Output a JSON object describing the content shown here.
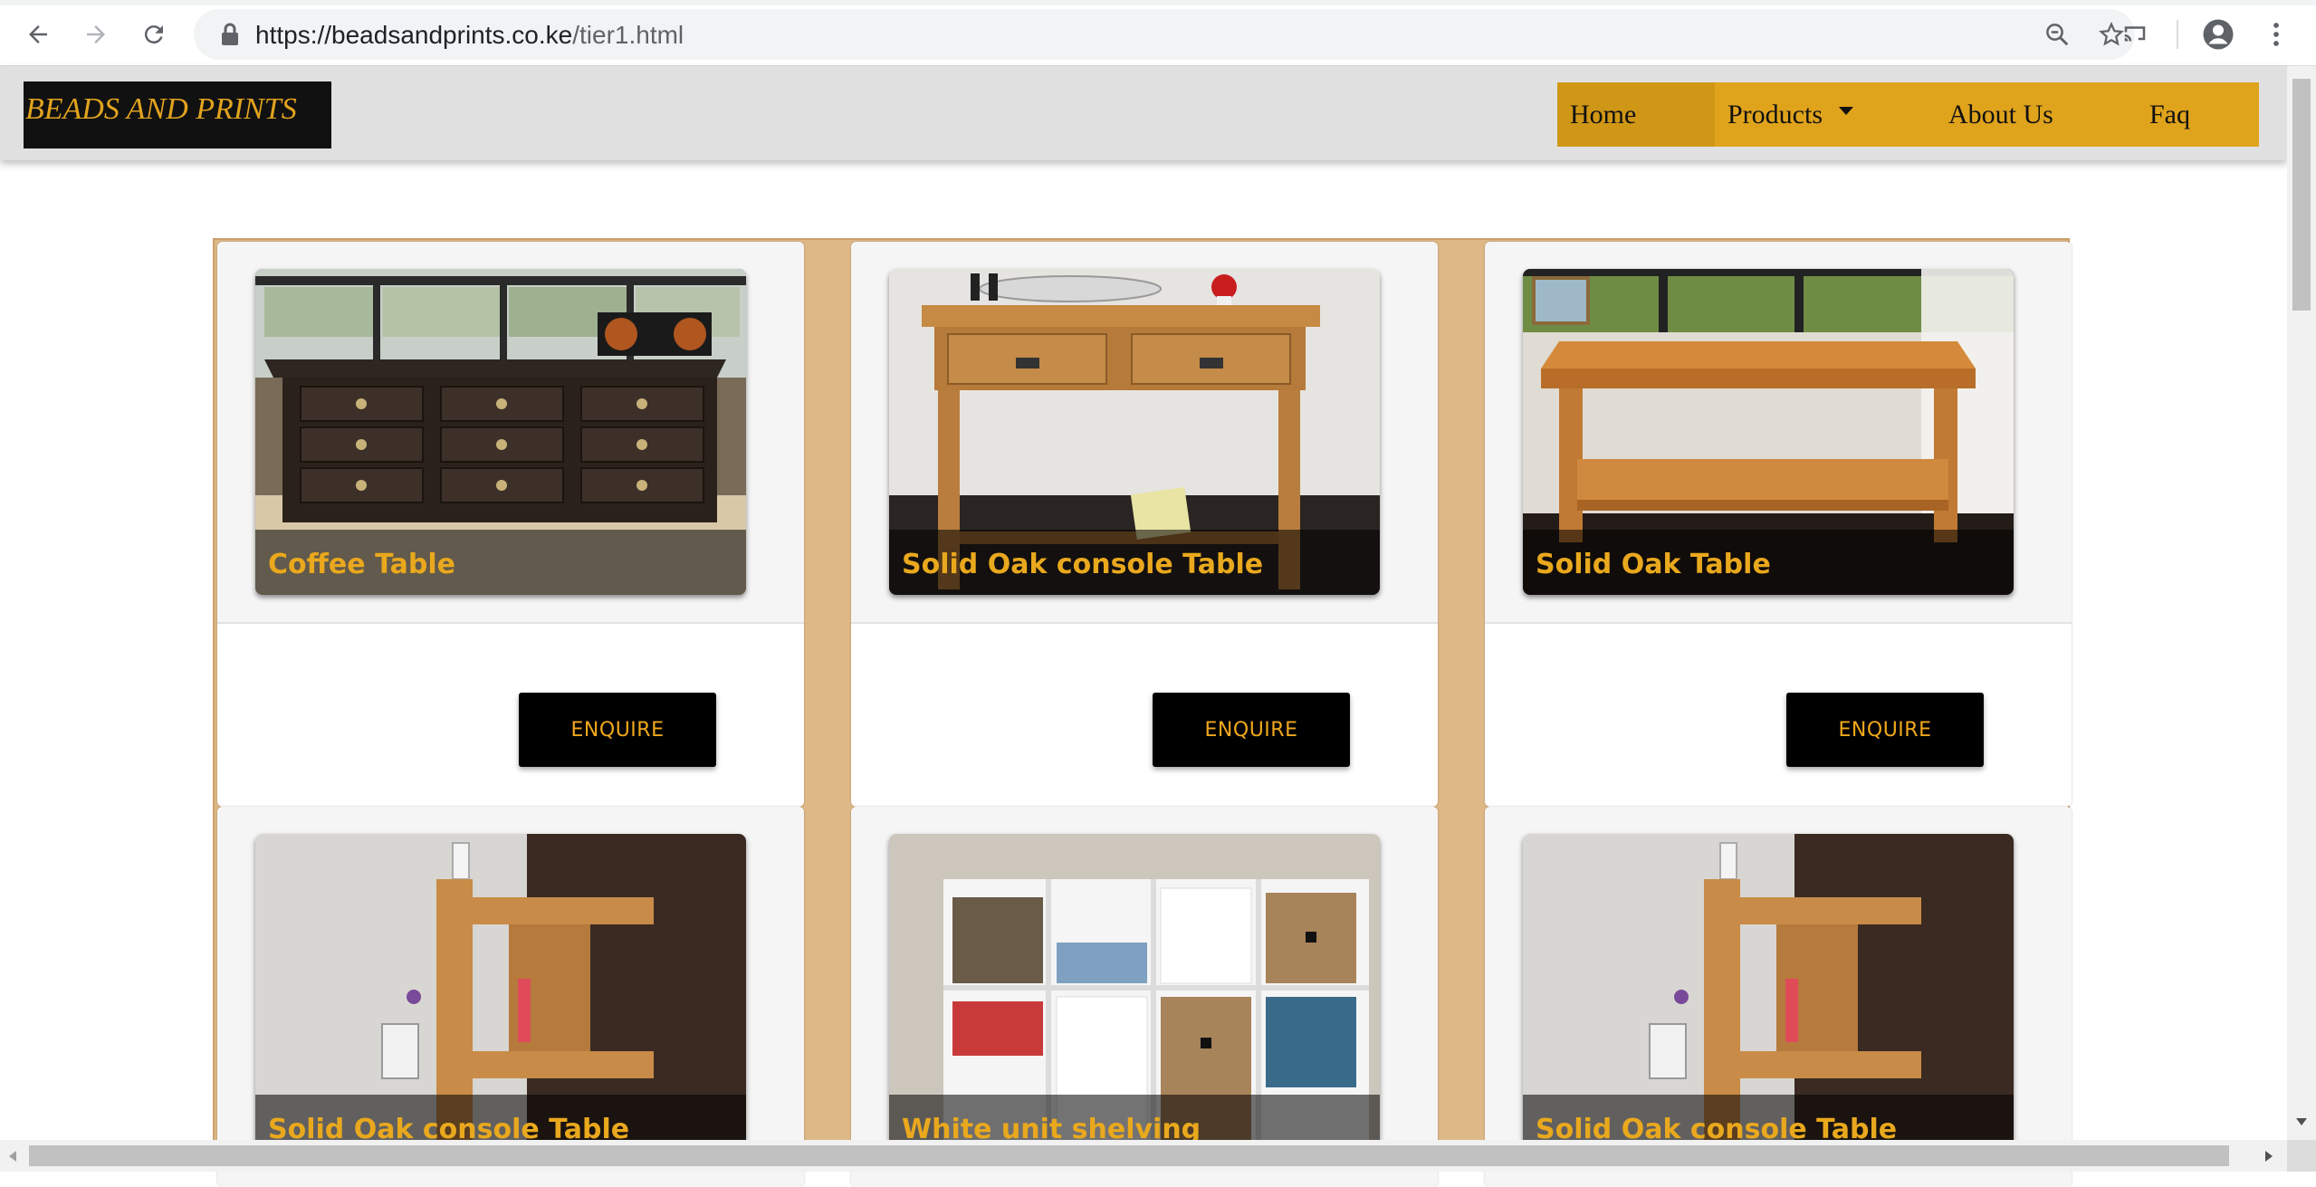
{
  "browser": {
    "url_host": "https://beadsandprints.co.ke",
    "url_path": "/tier1.html",
    "icons": [
      "back-arrow-icon",
      "forward-arrow-icon",
      "reload-icon",
      "lock-icon",
      "zoom-icon",
      "star-icon",
      "cast-icon",
      "account-icon",
      "more-vert-icon"
    ]
  },
  "site": {
    "brand": "BEADS AND PRINTS",
    "menu": [
      {
        "label": "Home",
        "active": true
      },
      {
        "label": "Products",
        "dropdown": true
      },
      {
        "label": "About Us"
      },
      {
        "label": "Faq"
      }
    ]
  },
  "products": [
    {
      "title": "Coffee Table",
      "button": "ENQUIRE",
      "image": "dark-wood-coffee-table"
    },
    {
      "title": "Solid Oak console Table",
      "button": "ENQUIRE",
      "image": "oak-console-table"
    },
    {
      "title": "Solid Oak Table",
      "button": "ENQUIRE",
      "image": "oak-table"
    },
    {
      "title": "Solid Oak console Table",
      "image": "oak-console-table-side"
    },
    {
      "title": "White unit shelving",
      "image": "white-cube-shelving"
    },
    {
      "title": "Solid Oak console Table",
      "image": "oak-console-table-side"
    }
  ],
  "colors": {
    "accent": "#dfa31c",
    "frame": "#deb887",
    "caption": "#e9a81d",
    "brand_bg": "#111111"
  }
}
